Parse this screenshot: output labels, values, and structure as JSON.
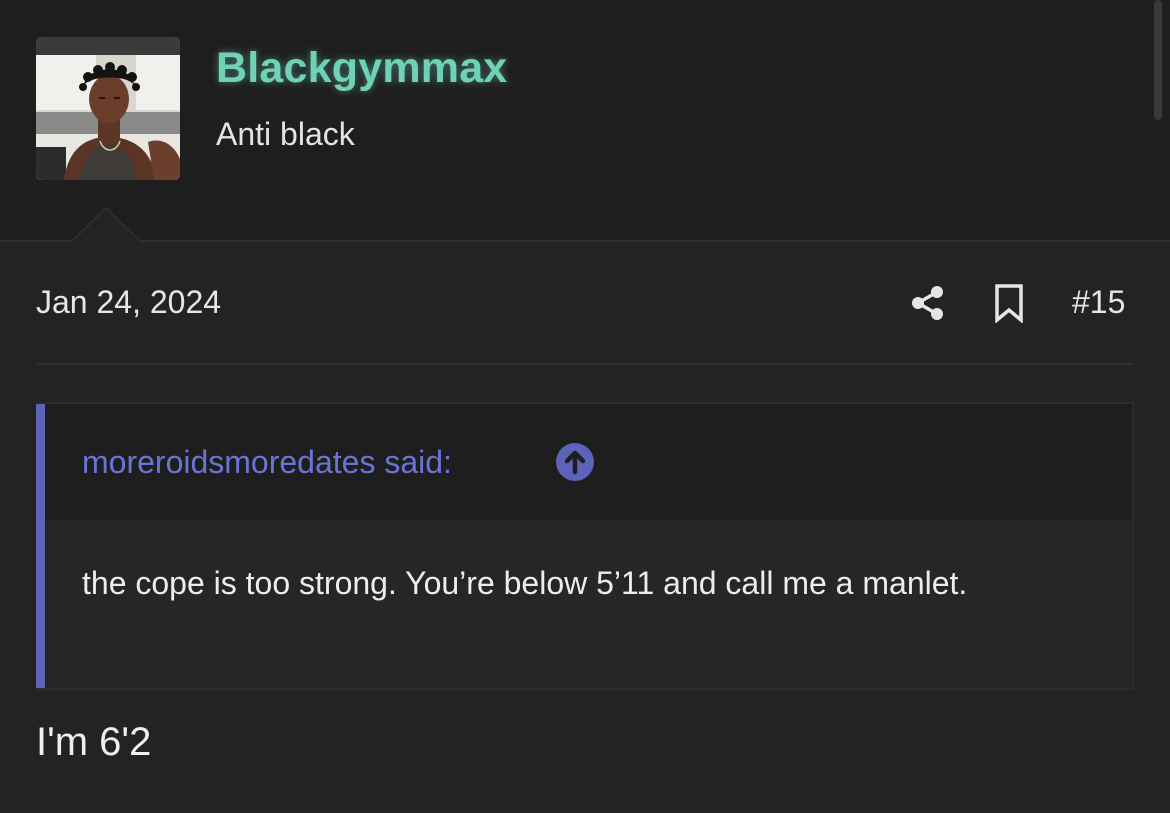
{
  "user": {
    "name": "Blackgymmax",
    "title": "Anti black",
    "name_color": "#6fd2b4"
  },
  "meta": {
    "date": "Jan 24, 2024",
    "post_number": "#15",
    "share_icon": "share-icon",
    "bookmark_icon": "bookmark-icon"
  },
  "quote": {
    "author": "moreroidsmoredates said:",
    "jump_icon": "arrow-up-circle-icon",
    "text": "the cope is too strong. You’re below 5’11 and call me a manlet.",
    "accent_color": "#5d63b8"
  },
  "reply": {
    "text": "I'm 6'2"
  }
}
